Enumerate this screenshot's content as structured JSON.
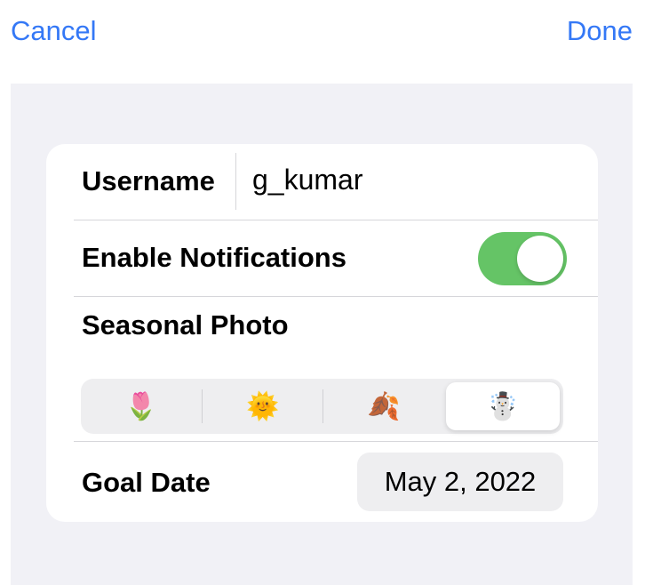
{
  "nav": {
    "cancel_label": "Cancel",
    "done_label": "Done"
  },
  "form": {
    "username": {
      "label": "Username",
      "value": "g_kumar"
    },
    "notifications": {
      "label": "Enable Notifications",
      "enabled": true
    },
    "seasonal_photo": {
      "label": "Seasonal Photo",
      "options": [
        {
          "icon": "tulip-icon",
          "glyph": "🌷"
        },
        {
          "icon": "sun-icon",
          "glyph": "🌞"
        },
        {
          "icon": "fallen-leaf-icon",
          "glyph": "🍂"
        },
        {
          "icon": "snowman-icon",
          "glyph": "☃️"
        }
      ],
      "selected_index": 3
    },
    "goal_date": {
      "label": "Goal Date",
      "value": "May 2, 2022"
    }
  },
  "colors": {
    "accent": "#3478f6",
    "toggle_on": "#65c466",
    "grouped_background": "#f1f1f6",
    "card_background": "#ffffff"
  }
}
